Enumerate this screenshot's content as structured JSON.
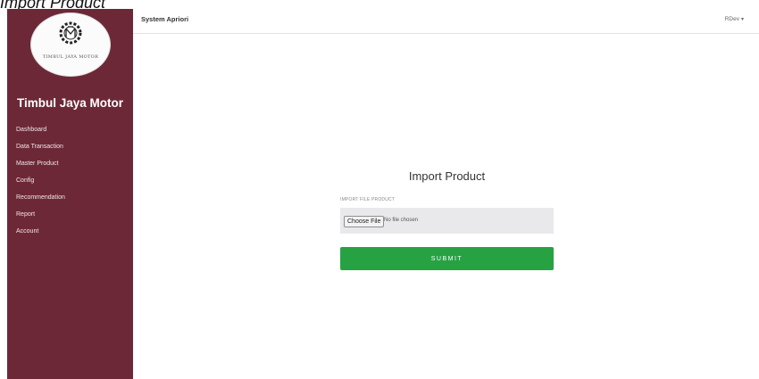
{
  "document": {
    "caption": "Import Product"
  },
  "sidebar": {
    "logo_text": "TIMBUL JAYA MOTOR",
    "brand": "Timbul Jaya Motor",
    "items": [
      {
        "label": "Dashboard"
      },
      {
        "label": "Data Transaction"
      },
      {
        "label": "Master Product"
      },
      {
        "label": "Config"
      },
      {
        "label": "Recommendation"
      },
      {
        "label": "Report"
      },
      {
        "label": "Account"
      }
    ]
  },
  "topbar": {
    "title": "System Apriori",
    "user": "RDev"
  },
  "form": {
    "title": "Import Product",
    "field_label": "IMPORT FILE PRODUCT",
    "choose_button": "Choose File",
    "file_status": "No file chosen",
    "submit_label": "SUBMIT"
  },
  "colors": {
    "sidebar": "#6d2837",
    "submit": "#27a243",
    "file_box": "#e9e9ec"
  }
}
